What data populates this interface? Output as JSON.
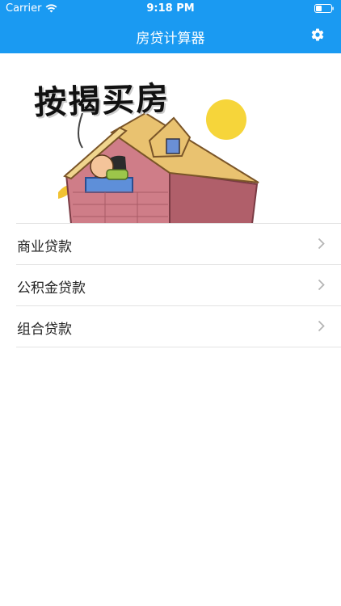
{
  "status_bar": {
    "carrier": "Carrier",
    "time": "9:18 PM",
    "wifi_icon": "wifi-icon",
    "battery_icon": "battery-icon"
  },
  "nav": {
    "title": "房贷计算器",
    "settings_icon": "gear-icon"
  },
  "banner": {
    "text": "按揭买房"
  },
  "menu": {
    "items": [
      {
        "label": "商业贷款"
      },
      {
        "label": "公积金贷款"
      },
      {
        "label": "组合贷款"
      }
    ]
  },
  "colors": {
    "accent": "#1a9af2",
    "divider": "#e3e3e3",
    "chevron": "#b5b5b5"
  }
}
